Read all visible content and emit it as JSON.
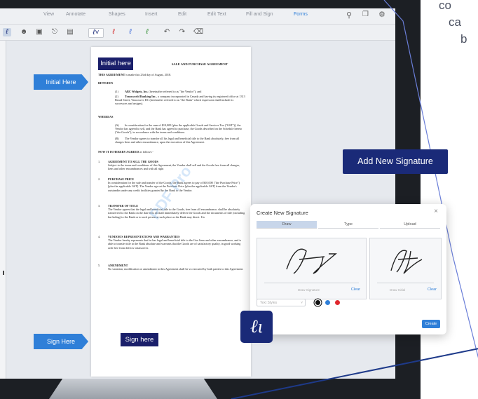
{
  "menu": {
    "items": [
      "View",
      "Annotate",
      "Shapes",
      "Insert",
      "Edit",
      "Edit Text",
      "Fill and Sign",
      "Forms"
    ],
    "active": "Forms",
    "accent_color": "#2f7fd8"
  },
  "toolbar": {
    "icons": [
      "signature-icon",
      "person-icon",
      "image-icon",
      "attachment-icon",
      "stamp-icon",
      "signature-dropdown-icon",
      "signature-red-icon",
      "initials-blue-icon",
      "signature-green-icon",
      "undo-icon",
      "redo-icon",
      "eraser-icon"
    ],
    "right_icons": [
      "search-icon",
      "pages-icon",
      "settings-icon"
    ]
  },
  "text_fragments": {
    "line1": "co",
    "line2": "ca",
    "line3": "b"
  },
  "callouts": {
    "initial_here": "Initial Here",
    "sign_here": "Sign Here"
  },
  "buttons": {
    "initial_here": "Initial here",
    "sign_here": "Sign here",
    "add_new_signature": "Add New Signature"
  },
  "document": {
    "title": "SALE AND PURCHASE AGREEMENT",
    "intro_bold": "THIS AGREEMENT",
    "intro_rest": " is made this 23rd day of August, 2018.",
    "between": "BETWEEN",
    "parties": [
      {
        "num": "(1)",
        "bold": "ABC Widgets, Inc.",
        "text": " (hereinafter referred to as \"the Vendor\"); and"
      },
      {
        "num": "(2)",
        "bold": "Transworld Banking Inc.",
        "text": ", a company incorporated in Canada and having its registered office at 1313 Broad Street, Vancouver, BC (hereinafter referred to as \"the Bank\" which expression shall include its successors and assigns)."
      }
    ],
    "whereas": "WHEREAS",
    "recitals": [
      {
        "num": "(A)",
        "text": "In consideration for the sum of $10,000 [plus the applicable Goods and Services Tax (\"GST\")], the Vendor has agreed to sell, and the Bank has agreed to purchase, the Goods described on the Schedule hereto (\"the Goods\"), in accordance with the terms and conditions."
      },
      {
        "num": "(B)",
        "text": "The Vendor agrees to transfer all his legal and beneficial title to the Bank absolutely, free from all charges liens and other encumbrance, upon the execution of this Agreement."
      }
    ],
    "agreed_bold": "NOW IT IS HEREBY AGREED",
    "agreed_rest": " as follows:-",
    "clauses": [
      {
        "num": "1.",
        "heading": "AGREEMENT TO SELL THE GOODS",
        "text": "Subject to the terms and conditions of this Agreement, the Vendor shall sell and the Goods free from all charges, liens and other encumbrances and with all right"
      },
      {
        "num": "2.",
        "heading": "PURCHASE PRICE",
        "text": "In consideration for the sale and transfer of the Goods, the Bank agrees to pay of $10,000 (\"the Purchase Price\") [plus the applicable GST]. The Vendor agr set the Purchase Price [plus the applicable GST] from the Vendor's outstandin under any credit facilities granted by the Bank to the Vendor."
      },
      {
        "num": "3.",
        "heading": "TRANSFER OF TITLE",
        "text": "The Vendor agrees that the legal and beneficial title to the Goods, free from all encumbrance, shall be absolutely transferred to the Bank on the date first ab shall immediately deliver the Goods and the documents of title (including but lading) to the Bank or to such person at such place as the Bank may direct. Un"
      },
      {
        "num": "4.",
        "heading": "VENDOR'S REPRESENTATIONS AND WARRANTIES",
        "text": "The Vendor hereby represents that he has legal and beneficial title to the Goo liens and other encumbrance, and is able to transfer title to the Bank absolute and warrants that the Goods are of satisfactory quality, in good working orde free from defects whatsoever."
      },
      {
        "num": "5.",
        "heading": "AMENDMENT",
        "text": "No variation, modification or amendment to this Agreement shall be va executed by both parties to this Agreement."
      }
    ],
    "watermark": "PDF Pro"
  },
  "dialog": {
    "title": "Create New Signature",
    "tabs": [
      "Draw",
      "Type",
      "Upload"
    ],
    "active_tab": "Draw",
    "signature_label": "Draw Signature",
    "initials_label": "Draw Initial",
    "clear": "Clear",
    "text_styles_placeholder": "Text Styles",
    "colors": [
      "#111111",
      "#2f7fd8",
      "#e0282e"
    ],
    "create": "Create"
  }
}
